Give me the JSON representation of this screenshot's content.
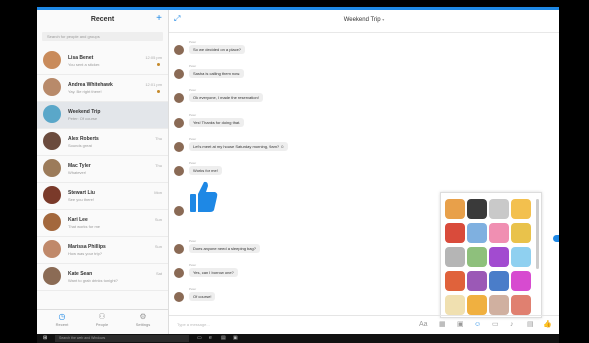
{
  "left": {
    "title": "Recent",
    "compose_icon": "compose-icon",
    "search_placeholder": "Search for people and groups",
    "conversations": [
      {
        "name": "Lisa Benet",
        "snippet": "You sent a sticker.",
        "time": "12:05 pm",
        "avatar_color": "#c98b5b"
      },
      {
        "name": "Andrea Whitehawk",
        "snippet": "Yay. Be right there!",
        "time": "12:01 pm",
        "avatar_color": "#b88a6a"
      },
      {
        "name": "Weekend Trip",
        "snippet": "Peter: Of course",
        "time": "",
        "avatar_color": "#5aa7c9"
      },
      {
        "name": "Alex Roberts",
        "snippet": "Sounds great",
        "time": "Thu",
        "avatar_color": "#6b4b3d"
      },
      {
        "name": "Mac Tyler",
        "snippet": "Whatever!",
        "time": "Thu",
        "avatar_color": "#9c7b5a"
      },
      {
        "name": "Stewart Liu",
        "snippet": "See you there!",
        "time": "Mon",
        "avatar_color": "#7a3a2a"
      },
      {
        "name": "Kari Lee",
        "snippet": "That works for me",
        "time": "Sun",
        "avatar_color": "#a3683d"
      },
      {
        "name": "Marissa Phillips",
        "snippet": "How was your trip?",
        "time": "Sun",
        "avatar_color": "#c0896a"
      },
      {
        "name": "Kate Sean",
        "snippet": "Want to grab drinks tonight?",
        "time": "Sat",
        "avatar_color": "#8b6b55"
      }
    ],
    "nav": [
      {
        "label": "Recent",
        "icon": "clock-icon"
      },
      {
        "label": "People",
        "icon": "people-icon"
      },
      {
        "label": "Settings",
        "icon": "gear-icon"
      }
    ]
  },
  "chat": {
    "title": "Weekend Trip",
    "title_arrow": "▾",
    "expand_icon": "expand-icon",
    "messages": [
      {
        "sender": "Peter",
        "text": "So we decided on a place?",
        "avatar_color": "#8a6a55"
      },
      {
        "sender": "Peter",
        "text": "Sasha is calling them now.",
        "avatar_color": "#8a6a55"
      },
      {
        "sender": "Peter",
        "text": "Ok everyone, I made the reservation!",
        "avatar_color": "#8a6a55"
      },
      {
        "sender": "Peter",
        "text": "Yes! Thanks for doing that.",
        "avatar_color": "#8a6a55"
      },
      {
        "sender": "Peter",
        "text": "Let's meet at my house Saturday morning, 9am? ☺",
        "avatar_color": "#8a6a55"
      },
      {
        "sender": "Peter",
        "text": "Works for me!",
        "avatar_color": "#8a6a55"
      },
      {
        "sender": "Peter",
        "text": "Does anyone need a sleeping bag?",
        "avatar_color": "#8a6a55"
      },
      {
        "sender": "Peter",
        "text": "Yes, can I borrow one?",
        "avatar_color": "#8a6a55"
      },
      {
        "sender": "Peter",
        "text": "Of course!",
        "avatar_color": "#8a6a55"
      }
    ],
    "composer_placeholder": "Type a message...",
    "composer_tools": [
      {
        "glyph": "Aa",
        "icon": "text-format-icon"
      },
      {
        "glyph": "▦",
        "icon": "camera-icon"
      },
      {
        "glyph": "▣",
        "icon": "image-icon"
      },
      {
        "glyph": "☺",
        "icon": "sticker-icon"
      },
      {
        "glyph": "▭",
        "icon": "gif-icon"
      },
      {
        "glyph": "♪",
        "icon": "microphone-icon"
      },
      {
        "glyph": "▤",
        "icon": "keyboard-icon"
      },
      {
        "glyph": "👍",
        "icon": "like-icon"
      }
    ],
    "stickers": [
      "#e8a04a",
      "#3a3a3a",
      "#c9c9c9",
      "#f3c04e",
      "#d94b3b",
      "#7fb0e0",
      "#f08fb2",
      "#e9c24b",
      "#b5b5b5",
      "#8ec07c",
      "#a24bd0",
      "#8fd0f0",
      "#e0623b",
      "#9b59b6",
      "#4a7dc9",
      "#d74bd0",
      "#f0e0b0",
      "#f0b040",
      "#d0b0a0",
      "#e08070"
    ]
  },
  "taskbar": {
    "start_glyph": "⊞",
    "search_text": "Search the web and Windows",
    "tray_text": ""
  }
}
